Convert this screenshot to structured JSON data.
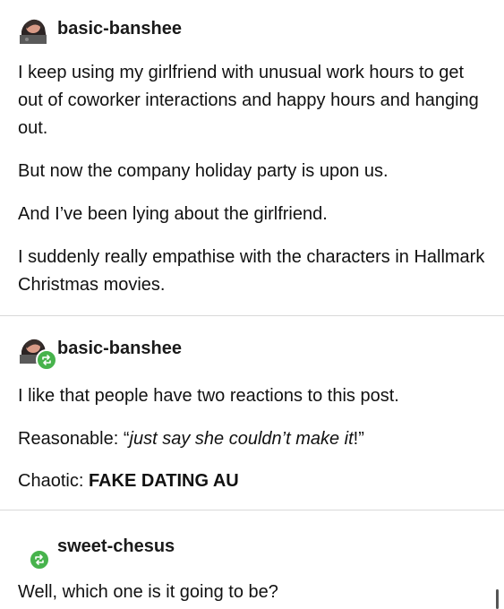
{
  "posts": [
    {
      "username": "basic-banshee",
      "reblogged": false,
      "paragraphs": [
        "I keep using my girlfriend with unusual work hours to get out of coworker interactions and happy hours and hanging out.",
        "But now the company holiday party is upon us.",
        "And I’ve been lying about the girlfriend.",
        "I suddenly really empathise with the characters in Hallmark Christmas movies."
      ]
    },
    {
      "username": "basic-banshee",
      "reblogged": true,
      "line1": "I like that people have two reactions to this post.",
      "line2_prefix": "Reasonable: ",
      "line2_quote_open": "“",
      "line2_italic": "just say she couldn’t make it",
      "line2_quote_close": "!”",
      "line3_prefix": "Chaotic: ",
      "line3_bold": "FAKE DATING AU"
    },
    {
      "username": "sweet-chesus",
      "reblogged": true,
      "line1": "Well, which one is it going to be?"
    }
  ],
  "icons": {
    "avatar": "user-avatar-icon",
    "reblog": "reblog-icon"
  },
  "colors": {
    "reblog_green": "#47b34c",
    "divider": "#d9d9d9"
  }
}
